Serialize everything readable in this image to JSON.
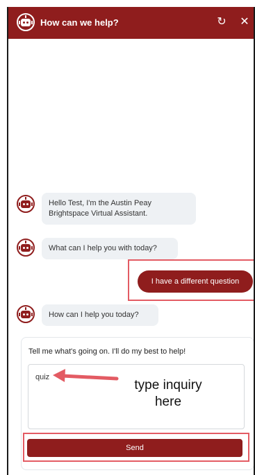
{
  "header": {
    "title": "How can we help?",
    "refresh_icon": "refresh-icon",
    "close_icon": "close-icon",
    "background": "#8f1d1d"
  },
  "messages": [
    {
      "sender": "bot",
      "text": "Hello Test, I'm the Austin Peay Brightspace Virtual Assistant."
    },
    {
      "sender": "bot",
      "text": "What can I help you with today?"
    },
    {
      "sender": "user",
      "text": "I have a different question"
    },
    {
      "sender": "bot",
      "text": "How can I help you today?"
    }
  ],
  "input_card": {
    "prompt": "Tell me what's going on. I'll do my best to help!",
    "textarea_value": "quiz",
    "send_label": "Send"
  },
  "annotation": {
    "text_line1": "type inquiry",
    "text_line2": "here",
    "color": "#e35b63"
  }
}
